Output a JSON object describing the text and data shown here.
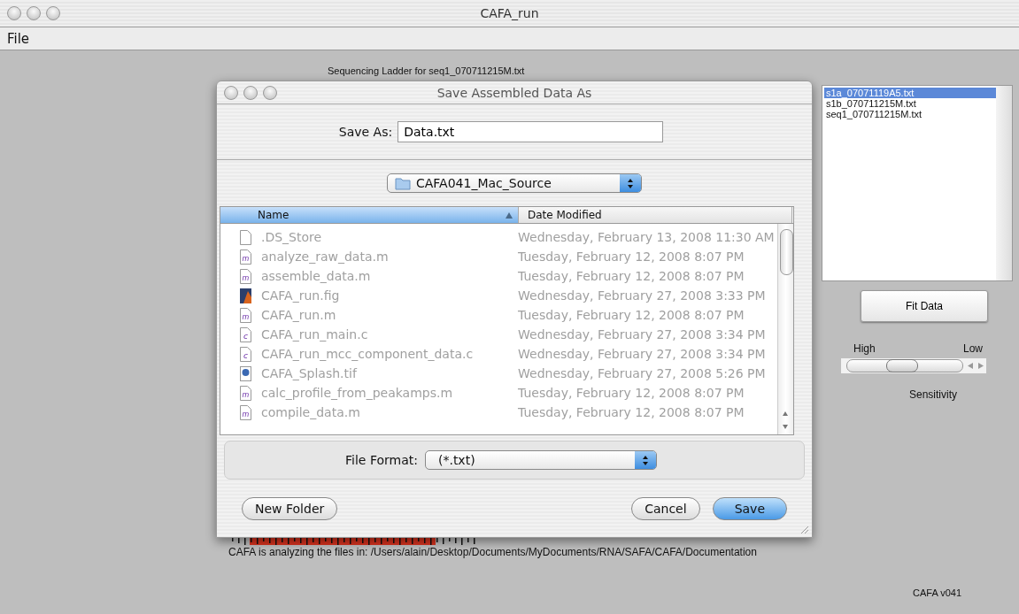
{
  "window": {
    "title": "CAFA_run"
  },
  "menu": [
    "File"
  ],
  "figure": {
    "ladder_title": "Sequencing Ladder for seq1_070711215M.txt",
    "status": "CAFA is analyzing the files in: /Users/alain/Desktop/Documents/MyDocuments/RNA/SAFA/CAFA/Documentation",
    "version": "CAFA v041",
    "files": [
      {
        "name": "s1a_07071119A5.txt",
        "selected": true
      },
      {
        "name": "s1b_070711215M.txt",
        "selected": false
      },
      {
        "name": "seq1_070711215M.txt",
        "selected": false
      }
    ],
    "fit_button": "Fit Data",
    "slider": {
      "left_label": "High",
      "right_label": "Low",
      "caption": "Sensitivity",
      "level": 0.47
    }
  },
  "dialog": {
    "title": "Save Assembled Data As",
    "save_as_label": "Save As:",
    "save_as_value": "Data.txt",
    "folder": "CAFA041_Mac_Source",
    "columns": [
      {
        "label": "Name",
        "selected": true
      },
      {
        "label": "Date Modified",
        "selected": false
      }
    ],
    "rows": [
      {
        "kind": "blank",
        "name": ".DS_Store",
        "date": "Wednesday, February 13, 2008 11:30 AM"
      },
      {
        "kind": "m",
        "name": "analyze_raw_data.m",
        "date": "Tuesday, February 12, 2008 8:07 PM"
      },
      {
        "kind": "m",
        "name": "assemble_data.m",
        "date": "Tuesday, February 12, 2008 8:07 PM"
      },
      {
        "kind": "fig",
        "name": "CAFA_run.fig",
        "date": "Wednesday, February 27, 2008 3:33 PM"
      },
      {
        "kind": "m",
        "name": "CAFA_run.m",
        "date": "Tuesday, February 12, 2008 8:07 PM"
      },
      {
        "kind": "c",
        "name": "CAFA_run_main.c",
        "date": "Wednesday, February 27, 2008 3:34 PM"
      },
      {
        "kind": "c",
        "name": "CAFA_run_mcc_component_data.c",
        "date": "Wednesday, February 27, 2008 3:34 PM"
      },
      {
        "kind": "tif",
        "name": "CAFA_Splash.tif",
        "date": "Wednesday, February 27, 2008 5:26 PM"
      },
      {
        "kind": "m",
        "name": "calc_profile_from_peakamps.m",
        "date": "Tuesday, February 12, 2008 8:07 PM"
      },
      {
        "kind": "m",
        "name": "compile_data.m",
        "date": "Tuesday, February 12, 2008 8:07 PM"
      }
    ],
    "format_label": "File Format:",
    "format_value": "(*.txt)",
    "buttons": [
      {
        "label": "New Folder",
        "kind": "plain"
      },
      {
        "label": "Cancel",
        "kind": "plain"
      },
      {
        "label": "Save",
        "kind": "default"
      }
    ]
  }
}
